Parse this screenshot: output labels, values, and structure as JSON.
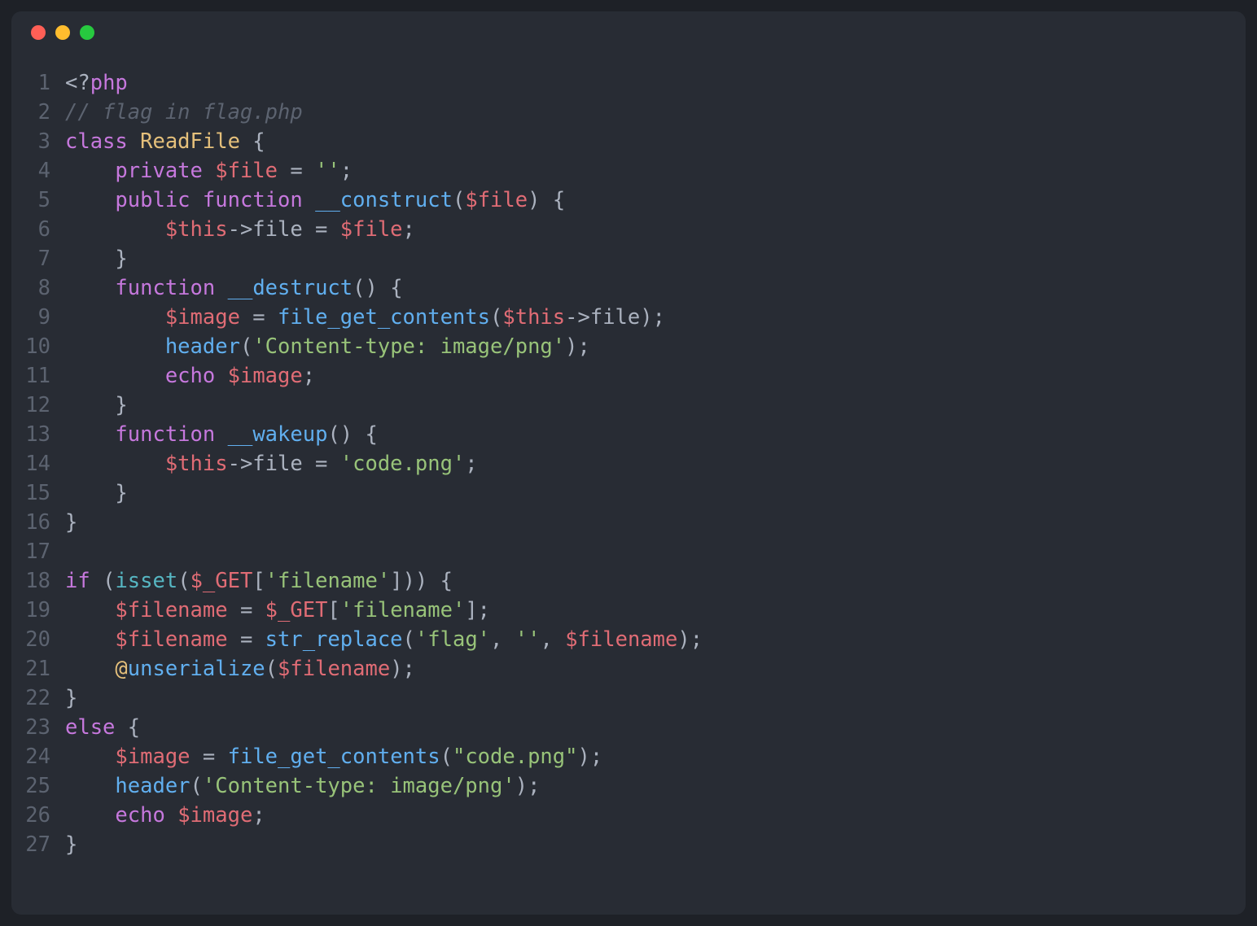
{
  "window": {
    "dots": [
      "close",
      "minimize",
      "zoom"
    ]
  },
  "code": {
    "lines": [
      {
        "n": 1,
        "tokens": [
          [
            "tk-def",
            "<?"
          ],
          [
            "tk-phpkw",
            "php"
          ]
        ]
      },
      {
        "n": 2,
        "tokens": [
          [
            "tk-com",
            "// flag in flag.php"
          ]
        ]
      },
      {
        "n": 3,
        "tokens": [
          [
            "tk-kw",
            "class"
          ],
          [
            "tk-def",
            " "
          ],
          [
            "tk-cls",
            "ReadFile"
          ],
          [
            "tk-def",
            " {"
          ]
        ]
      },
      {
        "n": 4,
        "tokens": [
          [
            "tk-def",
            "    "
          ],
          [
            "tk-kw",
            "private"
          ],
          [
            "tk-def",
            " "
          ],
          [
            "tk-var",
            "$file"
          ],
          [
            "tk-def",
            " = "
          ],
          [
            "tk-str",
            "''"
          ],
          [
            "tk-def",
            ";"
          ]
        ]
      },
      {
        "n": 5,
        "tokens": [
          [
            "tk-def",
            "    "
          ],
          [
            "tk-kw",
            "public"
          ],
          [
            "tk-def",
            " "
          ],
          [
            "tk-kw",
            "function"
          ],
          [
            "tk-def",
            " "
          ],
          [
            "tk-fn",
            "__construct"
          ],
          [
            "tk-def",
            "("
          ],
          [
            "tk-var",
            "$file"
          ],
          [
            "tk-def",
            ") {"
          ]
        ]
      },
      {
        "n": 6,
        "tokens": [
          [
            "tk-def",
            "        "
          ],
          [
            "tk-var",
            "$this"
          ],
          [
            "tk-def",
            "->file = "
          ],
          [
            "tk-var",
            "$file"
          ],
          [
            "tk-def",
            ";"
          ]
        ]
      },
      {
        "n": 7,
        "tokens": [
          [
            "tk-def",
            "    }"
          ]
        ]
      },
      {
        "n": 8,
        "tokens": [
          [
            "tk-def",
            "    "
          ],
          [
            "tk-kw",
            "function"
          ],
          [
            "tk-def",
            " "
          ],
          [
            "tk-fn",
            "__destruct"
          ],
          [
            "tk-def",
            "() {"
          ]
        ]
      },
      {
        "n": 9,
        "tokens": [
          [
            "tk-def",
            "        "
          ],
          [
            "tk-var",
            "$image"
          ],
          [
            "tk-def",
            " = "
          ],
          [
            "tk-fn",
            "file_get_contents"
          ],
          [
            "tk-def",
            "("
          ],
          [
            "tk-var",
            "$this"
          ],
          [
            "tk-def",
            "->file);"
          ]
        ]
      },
      {
        "n": 10,
        "tokens": [
          [
            "tk-def",
            "        "
          ],
          [
            "tk-fn",
            "header"
          ],
          [
            "tk-def",
            "("
          ],
          [
            "tk-str",
            "'Content-type: image/png'"
          ],
          [
            "tk-def",
            ");"
          ]
        ]
      },
      {
        "n": 11,
        "tokens": [
          [
            "tk-def",
            "        "
          ],
          [
            "tk-kw",
            "echo"
          ],
          [
            "tk-def",
            " "
          ],
          [
            "tk-var",
            "$image"
          ],
          [
            "tk-def",
            ";"
          ]
        ]
      },
      {
        "n": 12,
        "tokens": [
          [
            "tk-def",
            "    }"
          ]
        ]
      },
      {
        "n": 13,
        "tokens": [
          [
            "tk-def",
            "    "
          ],
          [
            "tk-kw",
            "function"
          ],
          [
            "tk-def",
            " "
          ],
          [
            "tk-fn",
            "__wakeup"
          ],
          [
            "tk-def",
            "() {"
          ]
        ]
      },
      {
        "n": 14,
        "tokens": [
          [
            "tk-def",
            "        "
          ],
          [
            "tk-var",
            "$this"
          ],
          [
            "tk-def",
            "->file = "
          ],
          [
            "tk-str",
            "'code.png'"
          ],
          [
            "tk-def",
            ";"
          ]
        ]
      },
      {
        "n": 15,
        "tokens": [
          [
            "tk-def",
            "    }"
          ]
        ]
      },
      {
        "n": 16,
        "tokens": [
          [
            "tk-def",
            "}"
          ]
        ]
      },
      {
        "n": 17,
        "tokens": [
          [
            "tk-def",
            ""
          ]
        ]
      },
      {
        "n": 18,
        "tokens": [
          [
            "tk-kw",
            "if"
          ],
          [
            "tk-def",
            " ("
          ],
          [
            "tk-builtin",
            "isset"
          ],
          [
            "tk-def",
            "("
          ],
          [
            "tk-var",
            "$_GET"
          ],
          [
            "tk-def",
            "["
          ],
          [
            "tk-str",
            "'filename'"
          ],
          [
            "tk-def",
            "])) {"
          ]
        ]
      },
      {
        "n": 19,
        "tokens": [
          [
            "tk-def",
            "    "
          ],
          [
            "tk-var",
            "$filename"
          ],
          [
            "tk-def",
            " = "
          ],
          [
            "tk-var",
            "$_GET"
          ],
          [
            "tk-def",
            "["
          ],
          [
            "tk-str",
            "'filename'"
          ],
          [
            "tk-def",
            "];"
          ]
        ]
      },
      {
        "n": 20,
        "tokens": [
          [
            "tk-def",
            "    "
          ],
          [
            "tk-var",
            "$filename"
          ],
          [
            "tk-def",
            " = "
          ],
          [
            "tk-fn",
            "str_replace"
          ],
          [
            "tk-def",
            "("
          ],
          [
            "tk-str",
            "'flag'"
          ],
          [
            "tk-def",
            ", "
          ],
          [
            "tk-str",
            "''"
          ],
          [
            "tk-def",
            ", "
          ],
          [
            "tk-var",
            "$filename"
          ],
          [
            "tk-def",
            ");"
          ]
        ]
      },
      {
        "n": 21,
        "tokens": [
          [
            "tk-def",
            "    "
          ],
          [
            "tk-cls",
            "@"
          ],
          [
            "tk-fn",
            "unserialize"
          ],
          [
            "tk-def",
            "("
          ],
          [
            "tk-var",
            "$filename"
          ],
          [
            "tk-def",
            ");"
          ]
        ]
      },
      {
        "n": 22,
        "tokens": [
          [
            "tk-def",
            "}"
          ]
        ]
      },
      {
        "n": 23,
        "tokens": [
          [
            "tk-kw",
            "else"
          ],
          [
            "tk-def",
            " {"
          ]
        ]
      },
      {
        "n": 24,
        "tokens": [
          [
            "tk-def",
            "    "
          ],
          [
            "tk-var",
            "$image"
          ],
          [
            "tk-def",
            " = "
          ],
          [
            "tk-fn",
            "file_get_contents"
          ],
          [
            "tk-def",
            "("
          ],
          [
            "tk-str",
            "\"code.png\""
          ],
          [
            "tk-def",
            ");"
          ]
        ]
      },
      {
        "n": 25,
        "tokens": [
          [
            "tk-def",
            "    "
          ],
          [
            "tk-fn",
            "header"
          ],
          [
            "tk-def",
            "("
          ],
          [
            "tk-str",
            "'Content-type: image/png'"
          ],
          [
            "tk-def",
            ");"
          ]
        ]
      },
      {
        "n": 26,
        "tokens": [
          [
            "tk-def",
            "    "
          ],
          [
            "tk-kw",
            "echo"
          ],
          [
            "tk-def",
            " "
          ],
          [
            "tk-var",
            "$image"
          ],
          [
            "tk-def",
            ";"
          ]
        ]
      },
      {
        "n": 27,
        "tokens": [
          [
            "tk-def",
            "}"
          ]
        ]
      }
    ]
  }
}
